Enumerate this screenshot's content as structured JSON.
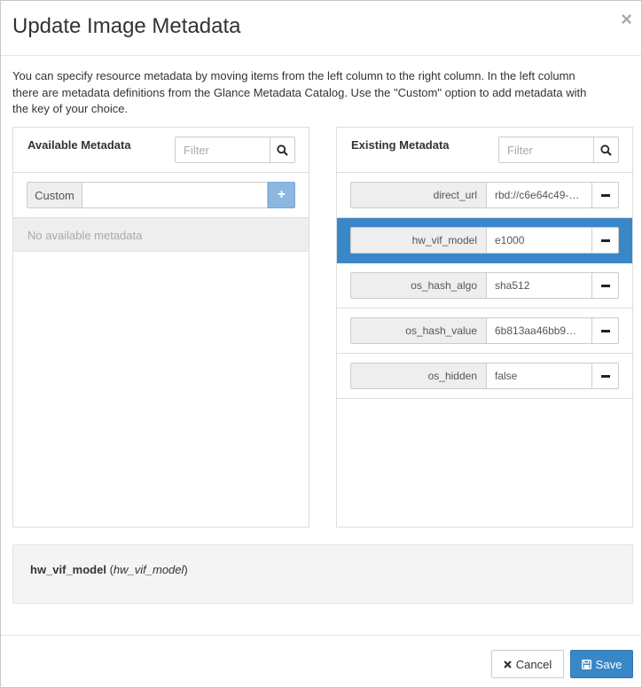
{
  "dialog": {
    "title": "Update Image Metadata",
    "close_label": "×",
    "intro": "You can specify resource metadata by moving items from the left column to the right column. In the left column there are metadata definitions from the Glance Metadata Catalog. Use the \"Custom\" option to add metadata with the key of your choice."
  },
  "available": {
    "title": "Available Metadata",
    "filter_placeholder": "Filter",
    "custom_label": "Custom",
    "custom_value": "",
    "add_label": "+",
    "empty_text": "No available metadata"
  },
  "existing": {
    "title": "Existing Metadata",
    "filter_placeholder": "Filter",
    "items": [
      {
        "key": "direct_url",
        "value": "rbd://c6e64c49-…"
      },
      {
        "key": "hw_vif_model",
        "value": "e1000"
      },
      {
        "key": "os_hash_algo",
        "value": "sha512"
      },
      {
        "key": "os_hash_value",
        "value": "6b813aa46bb9…"
      },
      {
        "key": "os_hidden",
        "value": "false"
      }
    ],
    "selected_index": 1
  },
  "info": {
    "key": "hw_vif_model",
    "open_paren": " (",
    "name": "hw_vif_model",
    "close_paren": ")"
  },
  "footer": {
    "cancel_label": "Cancel",
    "save_label": "Save"
  },
  "colors": {
    "primary": "#3a87c8",
    "add_button": "#8bb7e0"
  },
  "icons": {
    "close": "close-icon",
    "filter": "search-icon",
    "remove": "minus-icon",
    "cancel": "times-icon",
    "save": "floppy-disk-icon"
  }
}
